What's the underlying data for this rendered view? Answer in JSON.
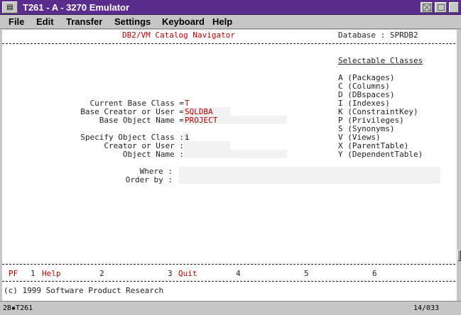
{
  "window": {
    "title": "T261 - A - 3270 Emulator",
    "system_icon": "terminal-icon"
  },
  "menu": [
    "File",
    "Edit",
    "Transfer",
    "Settings",
    "Keyboard",
    "Help"
  ],
  "header": {
    "app_title": "DB2/VM Catalog Navigator",
    "database": "Database : SPRDB2"
  },
  "selectable": {
    "heading": "Selectable Classes",
    "items": [
      "A (Packages)",
      "C (Columns)",
      "D (DBspaces)",
      "I (Indexes)",
      "K (ConstraintKey)",
      "P (Privileges)",
      "S (Synonyms)",
      "V (Views)",
      "X (ParentTable)",
      "Y (DependentTable)"
    ]
  },
  "form": {
    "current_base_class": {
      "label": "Current Base Class =",
      "value": "T"
    },
    "base_creator": {
      "label": "Base Creator or User =",
      "value": "SQLDBA"
    },
    "base_object_name": {
      "label": "Base Object Name =",
      "value": "PROJECT"
    },
    "specify_object_class": {
      "label": "Specify Object Class :",
      "value": "i"
    },
    "creator_or_user": {
      "label": "Creator or User :",
      "value": ""
    },
    "object_name": {
      "label": "Object Name :",
      "value": ""
    },
    "where": {
      "label": "Where :",
      "value": ""
    },
    "order_by": {
      "label": "Order by :",
      "value": ""
    }
  },
  "pf_keys": {
    "prefix": "PF",
    "keys": [
      {
        "num": "1",
        "label": "Help"
      },
      {
        "num": "2",
        "label": ""
      },
      {
        "num": "3",
        "label": "Quit"
      },
      {
        "num": "4",
        "label": ""
      },
      {
        "num": "5",
        "label": ""
      },
      {
        "num": "6",
        "label": ""
      }
    ]
  },
  "copyright": "(c) 1999 Software Product Research",
  "status": {
    "session": "2B▪T261",
    "cursor_pos": "14/033"
  }
}
